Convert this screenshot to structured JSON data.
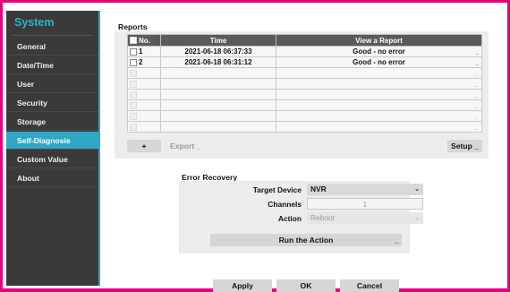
{
  "sidebar": {
    "title": "System",
    "items": [
      {
        "label": "General",
        "active": false
      },
      {
        "label": "Date/Time",
        "active": false
      },
      {
        "label": "User",
        "active": false
      },
      {
        "label": "Security",
        "active": false
      },
      {
        "label": "Storage",
        "active": false
      },
      {
        "label": "Self-Diagnosis",
        "active": true
      },
      {
        "label": "Custom Value",
        "active": false
      },
      {
        "label": "About",
        "active": false
      }
    ]
  },
  "reports": {
    "title": "Reports",
    "columns": [
      "No.",
      "Time",
      "View a Report"
    ],
    "rows": [
      {
        "no": "1",
        "time": "2021-06-18 06:37:33",
        "view": "Good - no error"
      },
      {
        "no": "2",
        "time": "2021-06-18 06:31:12",
        "view": "Good - no error"
      }
    ],
    "empty_rows": 6,
    "add_label": "+",
    "export_label": "Export",
    "setup_label": "Setup"
  },
  "error_recovery": {
    "title": "Error Recovery",
    "target_device_label": "Target Device",
    "target_device_value": "NVR",
    "channels_label": "Channels",
    "channels_value": "1",
    "action_label": "Action",
    "action_value": "Reboot",
    "run_label": "Run the Action"
  },
  "footer": {
    "apply_label": "Apply",
    "ok_label": "OK",
    "cancel_label": "Cancel"
  },
  "colors": {
    "frame": "#e5007e",
    "sidebar_bg": "#3a3a3a",
    "accent": "#2ea7c7",
    "header_bg": "#5a5a5a"
  }
}
